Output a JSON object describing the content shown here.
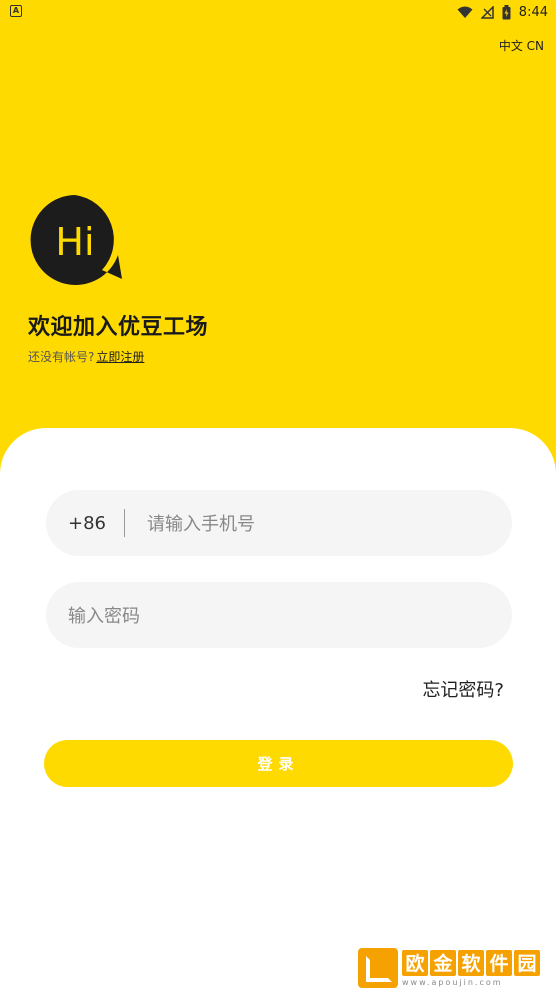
{
  "status_bar": {
    "left_icon": "A",
    "time": "8:44",
    "icons": [
      "wifi-icon",
      "signal-icon",
      "battery-icon"
    ]
  },
  "header": {
    "language": "中文 CN"
  },
  "logo": {
    "text": "Hi"
  },
  "welcome": {
    "title": "欢迎加入优豆工场",
    "no_account": "还没有帐号?",
    "register_link": "立即注册"
  },
  "form": {
    "country_code": "+86",
    "phone_placeholder": "请输入手机号",
    "password_placeholder": "输入密码",
    "forgot_password": "忘记密码?",
    "login_label": "登录"
  },
  "watermark": {
    "chars": [
      "欧",
      "金",
      "软",
      "件",
      "园"
    ],
    "url": "www.apoujin.com"
  },
  "colors": {
    "brand_yellow": "#FFDA00",
    "card_bg": "#FFFFFF",
    "field_bg": "#F5F5F5",
    "watermark_orange": "#F5A100"
  }
}
